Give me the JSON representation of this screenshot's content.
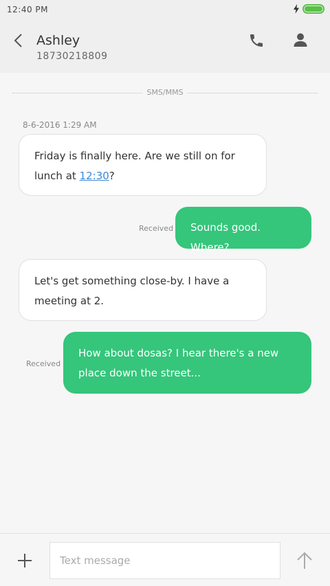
{
  "status_bar": {
    "time": "12:40 PM"
  },
  "header": {
    "contact_name": "Ashley",
    "contact_number": "18730218809"
  },
  "thread": {
    "divider_label": "SMS/MMS",
    "timestamp": "8-6-2016 1:29 AM",
    "messages": [
      {
        "direction": "incoming",
        "text_before": "Friday is finally here. Are we still on for lunch at ",
        "link": "12:30",
        "text_after": "?"
      },
      {
        "direction": "outgoing",
        "text": "Sounds good. Where?",
        "status": "Received"
      },
      {
        "direction": "incoming",
        "text": "Let's get something close-by. I have a meeting at 2."
      },
      {
        "direction": "outgoing",
        "text": "How about dosas? I hear there's a new place down the street...",
        "status": "Received"
      }
    ]
  },
  "composer": {
    "placeholder": "Text message",
    "value": ""
  },
  "colors": {
    "outgoing_bubble": "#35c57b",
    "battery": "#5ac04a",
    "link": "#3a8ad6"
  },
  "icons": [
    "bolt-icon",
    "battery-icon",
    "back-icon",
    "phone-icon",
    "person-icon",
    "add-icon",
    "send-icon"
  ]
}
